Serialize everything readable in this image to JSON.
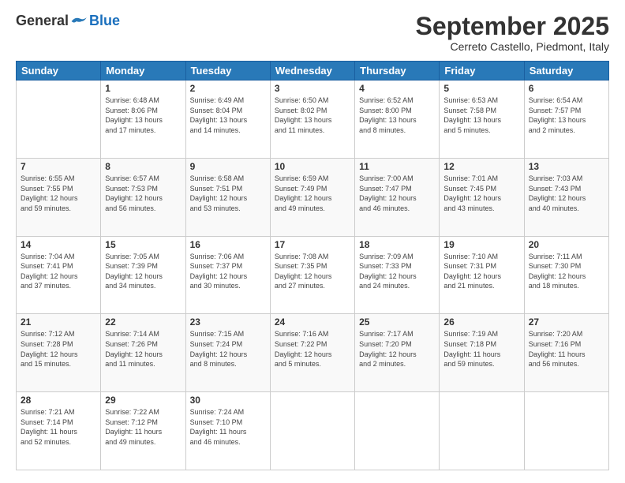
{
  "header": {
    "logo_general": "General",
    "logo_blue": "Blue",
    "month_title": "September 2025",
    "location": "Cerreto Castello, Piedmont, Italy"
  },
  "days_of_week": [
    "Sunday",
    "Monday",
    "Tuesday",
    "Wednesday",
    "Thursday",
    "Friday",
    "Saturday"
  ],
  "weeks": [
    [
      {
        "day": "",
        "content": ""
      },
      {
        "day": "1",
        "content": "Sunrise: 6:48 AM\nSunset: 8:06 PM\nDaylight: 13 hours\nand 17 minutes."
      },
      {
        "day": "2",
        "content": "Sunrise: 6:49 AM\nSunset: 8:04 PM\nDaylight: 13 hours\nand 14 minutes."
      },
      {
        "day": "3",
        "content": "Sunrise: 6:50 AM\nSunset: 8:02 PM\nDaylight: 13 hours\nand 11 minutes."
      },
      {
        "day": "4",
        "content": "Sunrise: 6:52 AM\nSunset: 8:00 PM\nDaylight: 13 hours\nand 8 minutes."
      },
      {
        "day": "5",
        "content": "Sunrise: 6:53 AM\nSunset: 7:58 PM\nDaylight: 13 hours\nand 5 minutes."
      },
      {
        "day": "6",
        "content": "Sunrise: 6:54 AM\nSunset: 7:57 PM\nDaylight: 13 hours\nand 2 minutes."
      }
    ],
    [
      {
        "day": "7",
        "content": "Sunrise: 6:55 AM\nSunset: 7:55 PM\nDaylight: 12 hours\nand 59 minutes."
      },
      {
        "day": "8",
        "content": "Sunrise: 6:57 AM\nSunset: 7:53 PM\nDaylight: 12 hours\nand 56 minutes."
      },
      {
        "day": "9",
        "content": "Sunrise: 6:58 AM\nSunset: 7:51 PM\nDaylight: 12 hours\nand 53 minutes."
      },
      {
        "day": "10",
        "content": "Sunrise: 6:59 AM\nSunset: 7:49 PM\nDaylight: 12 hours\nand 49 minutes."
      },
      {
        "day": "11",
        "content": "Sunrise: 7:00 AM\nSunset: 7:47 PM\nDaylight: 12 hours\nand 46 minutes."
      },
      {
        "day": "12",
        "content": "Sunrise: 7:01 AM\nSunset: 7:45 PM\nDaylight: 12 hours\nand 43 minutes."
      },
      {
        "day": "13",
        "content": "Sunrise: 7:03 AM\nSunset: 7:43 PM\nDaylight: 12 hours\nand 40 minutes."
      }
    ],
    [
      {
        "day": "14",
        "content": "Sunrise: 7:04 AM\nSunset: 7:41 PM\nDaylight: 12 hours\nand 37 minutes."
      },
      {
        "day": "15",
        "content": "Sunrise: 7:05 AM\nSunset: 7:39 PM\nDaylight: 12 hours\nand 34 minutes."
      },
      {
        "day": "16",
        "content": "Sunrise: 7:06 AM\nSunset: 7:37 PM\nDaylight: 12 hours\nand 30 minutes."
      },
      {
        "day": "17",
        "content": "Sunrise: 7:08 AM\nSunset: 7:35 PM\nDaylight: 12 hours\nand 27 minutes."
      },
      {
        "day": "18",
        "content": "Sunrise: 7:09 AM\nSunset: 7:33 PM\nDaylight: 12 hours\nand 24 minutes."
      },
      {
        "day": "19",
        "content": "Sunrise: 7:10 AM\nSunset: 7:31 PM\nDaylight: 12 hours\nand 21 minutes."
      },
      {
        "day": "20",
        "content": "Sunrise: 7:11 AM\nSunset: 7:30 PM\nDaylight: 12 hours\nand 18 minutes."
      }
    ],
    [
      {
        "day": "21",
        "content": "Sunrise: 7:12 AM\nSunset: 7:28 PM\nDaylight: 12 hours\nand 15 minutes."
      },
      {
        "day": "22",
        "content": "Sunrise: 7:14 AM\nSunset: 7:26 PM\nDaylight: 12 hours\nand 11 minutes."
      },
      {
        "day": "23",
        "content": "Sunrise: 7:15 AM\nSunset: 7:24 PM\nDaylight: 12 hours\nand 8 minutes."
      },
      {
        "day": "24",
        "content": "Sunrise: 7:16 AM\nSunset: 7:22 PM\nDaylight: 12 hours\nand 5 minutes."
      },
      {
        "day": "25",
        "content": "Sunrise: 7:17 AM\nSunset: 7:20 PM\nDaylight: 12 hours\nand 2 minutes."
      },
      {
        "day": "26",
        "content": "Sunrise: 7:19 AM\nSunset: 7:18 PM\nDaylight: 11 hours\nand 59 minutes."
      },
      {
        "day": "27",
        "content": "Sunrise: 7:20 AM\nSunset: 7:16 PM\nDaylight: 11 hours\nand 56 minutes."
      }
    ],
    [
      {
        "day": "28",
        "content": "Sunrise: 7:21 AM\nSunset: 7:14 PM\nDaylight: 11 hours\nand 52 minutes."
      },
      {
        "day": "29",
        "content": "Sunrise: 7:22 AM\nSunset: 7:12 PM\nDaylight: 11 hours\nand 49 minutes."
      },
      {
        "day": "30",
        "content": "Sunrise: 7:24 AM\nSunset: 7:10 PM\nDaylight: 11 hours\nand 46 minutes."
      },
      {
        "day": "",
        "content": ""
      },
      {
        "day": "",
        "content": ""
      },
      {
        "day": "",
        "content": ""
      },
      {
        "day": "",
        "content": ""
      }
    ]
  ]
}
